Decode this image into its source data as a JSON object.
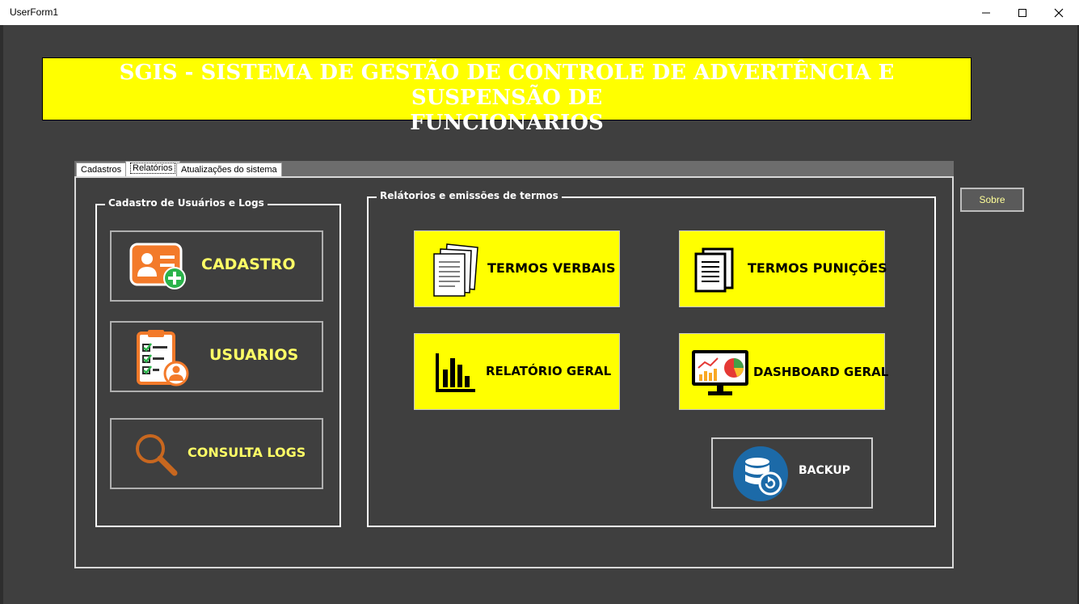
{
  "window": {
    "title": "UserForm1"
  },
  "banner": {
    "line1": "SGIS - SISTEMA DE GESTÃO DE CONTROLE DE ADVERTÊNCIA E SUSPENSÃO DE",
    "line2": "FUNCIONARIOS"
  },
  "tabs": [
    {
      "label": "Cadastros"
    },
    {
      "label": "Relatórios",
      "active": true
    },
    {
      "label": "Atualizações do sistema"
    }
  ],
  "left_frame": {
    "caption": "Cadastro de Usuários e Logs",
    "buttons": [
      {
        "label": "CADASTRO",
        "icon": "user-card-add-icon"
      },
      {
        "label": "USUARIOS",
        "icon": "clipboard-user-icon"
      },
      {
        "label": "CONSULTA LOGS",
        "icon": "magnifier-icon"
      }
    ]
  },
  "right_frame": {
    "caption": "Relátorios e emissões de termos",
    "buttons": [
      {
        "label": "TERMOS VERBAIS",
        "icon": "documents-icon"
      },
      {
        "label": "TERMOS PUNIÇÕES",
        "icon": "document-list-icon"
      },
      {
        "label": "RELATÓRIO GERAL",
        "icon": "bar-chart-icon"
      },
      {
        "label": "DASHBOARD GERAL",
        "icon": "dashboard-monitor-icon"
      },
      {
        "label": "BACKUP",
        "icon": "database-restore-icon"
      }
    ]
  },
  "sobre_button": {
    "label": "Sobre"
  },
  "colors": {
    "background": "#3f3f3f",
    "accent": "#ffff00",
    "label_yellow": "#ffff66",
    "orange_icon": "#f37a2a",
    "backup_blue": "#1c6aa8"
  }
}
